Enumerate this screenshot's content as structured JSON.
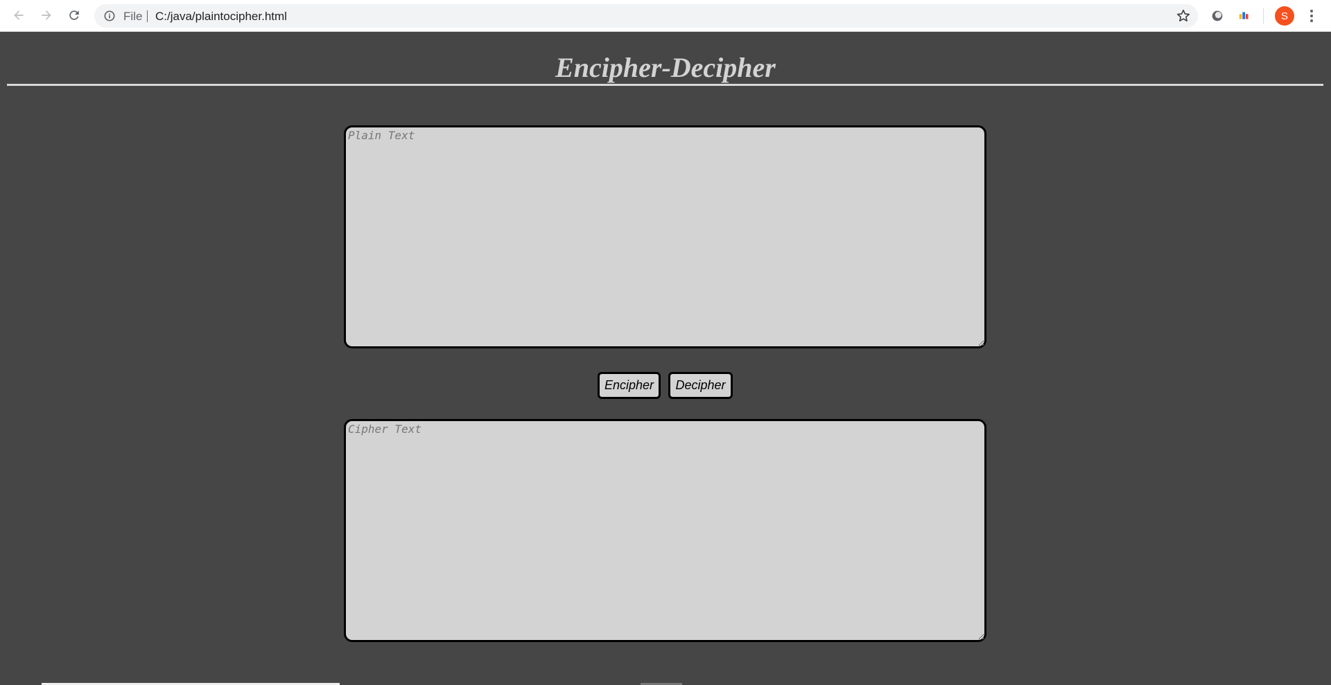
{
  "browser": {
    "scheme_label": "File",
    "url": "C:/java/plaintocipher.html",
    "avatar_initial": "S",
    "icons": [
      "back-arrow-icon",
      "forward-arrow-icon",
      "reload-icon",
      "info-icon",
      "star-icon",
      "extension-icon",
      "extension-icon",
      "more-icon"
    ]
  },
  "page": {
    "title": "Encipher-Decipher",
    "plain_placeholder": "Plain Text",
    "plain_value": "",
    "cipher_placeholder": "Cipher Text",
    "cipher_value": "",
    "encipher_label": "Encipher",
    "decipher_label": "Decipher"
  },
  "colors": {
    "background": "#464646",
    "textbox": "#d3d3d3",
    "title": "#d3d3d3",
    "avatar": "#f4511e"
  }
}
